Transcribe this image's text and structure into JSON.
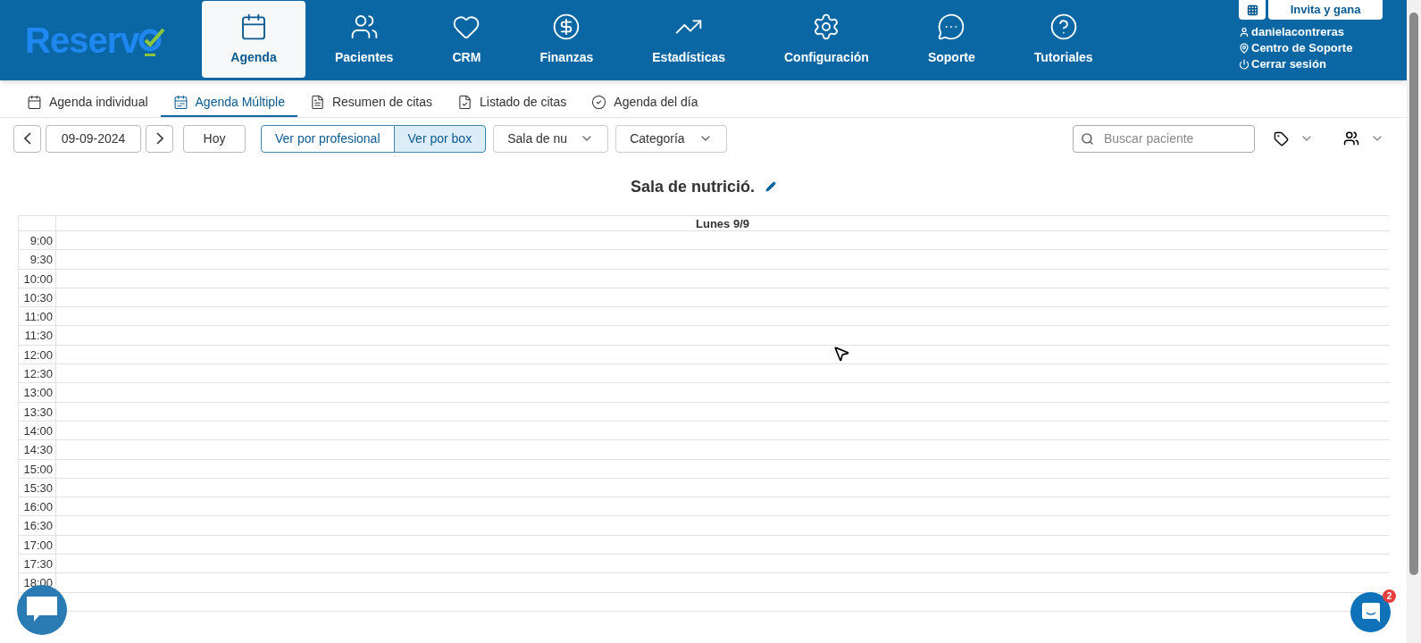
{
  "header": {
    "logo": "Reserv",
    "nav": [
      {
        "label": "Agenda",
        "selected": true
      },
      {
        "label": "Pacientes",
        "selected": false
      },
      {
        "label": "CRM",
        "selected": false
      },
      {
        "label": "Finanzas",
        "selected": false
      },
      {
        "label": "Estadísticas",
        "selected": false
      },
      {
        "label": "Configuración",
        "selected": false
      },
      {
        "label": "Soporte",
        "selected": false
      },
      {
        "label": "Tutoriales",
        "selected": false
      }
    ],
    "invite_button": "Invita y gana",
    "user_links": [
      "danielacontreras",
      "Centro de Soporte",
      "Cerrar sesión"
    ]
  },
  "tabs": [
    {
      "label": "Agenda individual",
      "selected": false
    },
    {
      "label": "Agenda Múltiple",
      "selected": true
    },
    {
      "label": "Resumen de citas",
      "selected": false
    },
    {
      "label": "Listado de citas",
      "selected": false
    },
    {
      "label": "Agenda del día",
      "selected": false
    }
  ],
  "toolbar": {
    "date": "09-09-2024",
    "today_button": "Hoy",
    "view_toggle": [
      {
        "label": "Ver por profesional",
        "selected": false
      },
      {
        "label": "Ver por box",
        "selected": true
      }
    ],
    "dropdowns": [
      "Sala de nu",
      "Categoría"
    ],
    "search": {
      "placeholder": "Buscar paciente"
    }
  },
  "calendar": {
    "title": "Sala de nutrició.",
    "day_header": "Lunes 9/9",
    "times": [
      "9:00",
      "9:30",
      "10:00",
      "10:30",
      "11:00",
      "11:30",
      "12:00",
      "12:30",
      "13:00",
      "13:30",
      "14:00",
      "14:30",
      "15:00",
      "15:30",
      "16:00",
      "16:30",
      "17:00",
      "17:30",
      "18:00"
    ]
  },
  "chat_badge": "2"
}
